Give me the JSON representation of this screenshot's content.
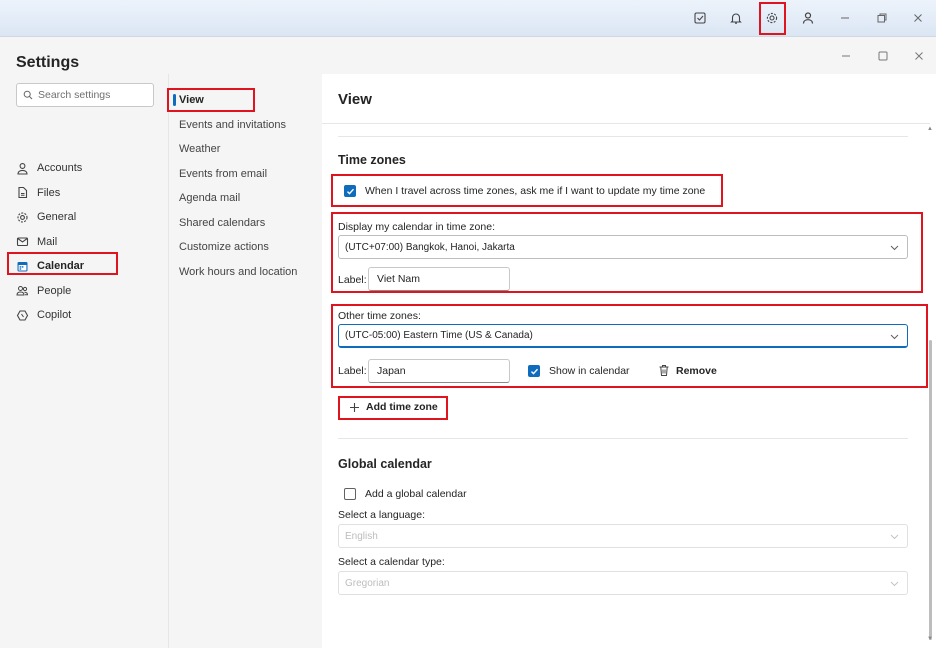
{
  "appbar": {
    "icons": [
      "tasks-icon",
      "bell-icon",
      "gear-icon",
      "person-icon",
      "minimize-icon",
      "restore-icon",
      "close-icon"
    ]
  },
  "dialog": {
    "controls": {
      "minimize": "–",
      "maximize": "▢",
      "close": "✕"
    }
  },
  "sidebar": {
    "title": "Settings",
    "search_placeholder": "Search settings",
    "items": [
      {
        "label": "Accounts",
        "icon": "person-icon"
      },
      {
        "label": "Files",
        "icon": "file-icon"
      },
      {
        "label": "General",
        "icon": "gear-icon"
      },
      {
        "label": "Mail",
        "icon": "mail-icon"
      },
      {
        "label": "Calendar",
        "icon": "calendar-icon",
        "active": true
      },
      {
        "label": "People",
        "icon": "people-icon"
      },
      {
        "label": "Copilot",
        "icon": "copilot-icon"
      }
    ]
  },
  "subnav": {
    "items": [
      {
        "label": "View",
        "active": true
      },
      {
        "label": "Events and invitations"
      },
      {
        "label": "Weather"
      },
      {
        "label": "Events from email"
      },
      {
        "label": "Agenda mail"
      },
      {
        "label": "Shared calendars"
      },
      {
        "label": "Customize actions"
      },
      {
        "label": "Work hours and location"
      }
    ]
  },
  "main": {
    "title": "View",
    "time_zones": {
      "heading": "Time zones",
      "travel_prompt": "When I travel across time zones, ask me if I want to update my time zone",
      "display_label": "Display my calendar in time zone:",
      "display_value": "(UTC+07:00) Bangkok, Hanoi, Jakarta",
      "label_text": "Label:",
      "display_label_value": "Viet Nam",
      "other_label": "Other time zones:",
      "other_value": "(UTC-05:00) Eastern Time (US & Canada)",
      "other_label_value": "Japan",
      "show_in_calendar": "Show in calendar",
      "remove": "Remove",
      "add": "Add time zone"
    },
    "global_calendar": {
      "heading": "Global calendar",
      "add_label": "Add a global calendar",
      "language_label": "Select a language:",
      "language_value": "English",
      "type_label": "Select a calendar type:",
      "type_value": "Gregorian"
    }
  },
  "colors": {
    "accent": "#0f6cbd",
    "highlight": "#e0141e"
  }
}
